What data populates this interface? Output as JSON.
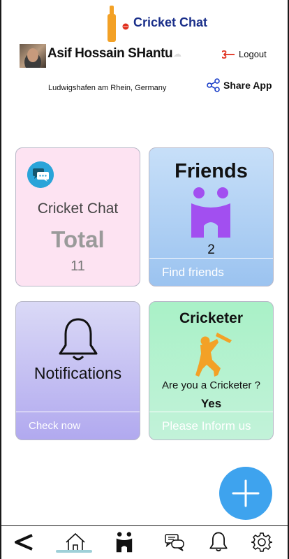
{
  "header": {
    "app_title": "Cricket Chat",
    "user_name": "Asif Hossain SHantu",
    "location": "Ludwigshafen am Rhein, Germany",
    "logout_label": "Logout",
    "share_label": "Share App",
    "logo_icon": "cricket-bat-ball-icon",
    "badge_glyph": "☁"
  },
  "cards": {
    "chat": {
      "title": "Cricket Chat",
      "total_label": "Total",
      "count": "11",
      "icon": "chat-bubbles-icon"
    },
    "friends": {
      "title": "Friends",
      "count": "2",
      "footer": "Find friends",
      "icon": "friends-people-icon"
    },
    "notifications": {
      "title": "Notifications",
      "footer": "Check now",
      "icon": "bell-icon"
    },
    "cricketer": {
      "title": "Cricketer",
      "question": "Are you a Cricketer ?",
      "answer": "Yes",
      "footer": "Please Inform us",
      "icon": "batsman-icon"
    }
  },
  "fab": {
    "icon": "plus-icon"
  },
  "bottom_nav": {
    "items": [
      {
        "icon": "back-chevron-icon"
      },
      {
        "icon": "home-icon",
        "active": true
      },
      {
        "icon": "friends-icon"
      },
      {
        "icon": "chat-icon"
      },
      {
        "icon": "bell-icon"
      },
      {
        "icon": "gear-icon"
      }
    ]
  },
  "colors": {
    "title_blue": "#1a2f8a",
    "chat_card": "#fde3f2",
    "friends_card": "#9bc3f0",
    "notifications_card": "#b1a9ef",
    "cricketer_card": "#a9f1c7",
    "purple_icon": "#a24ff0",
    "orange_icon": "#f3a126",
    "fab": "#3ea3ee",
    "logout_red": "#e0301e"
  }
}
